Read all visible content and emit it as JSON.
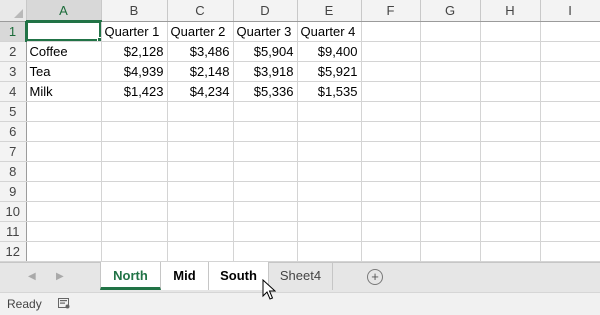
{
  "columns": [
    "A",
    "B",
    "C",
    "D",
    "E",
    "F",
    "G",
    "H",
    "I"
  ],
  "rows": [
    {
      "num": "1",
      "cells": [
        "",
        "Quarter 1",
        "Quarter 2",
        "Quarter 3",
        "Quarter 4",
        "",
        "",
        "",
        ""
      ]
    },
    {
      "num": "2",
      "cells": [
        "Coffee",
        "$2,128",
        "$3,486",
        "$5,904",
        "$9,400",
        "",
        "",
        "",
        ""
      ]
    },
    {
      "num": "3",
      "cells": [
        "Tea",
        "$4,939",
        "$2,148",
        "$3,918",
        "$5,921",
        "",
        "",
        "",
        ""
      ]
    },
    {
      "num": "4",
      "cells": [
        "Milk",
        "$1,423",
        "$4,234",
        "$5,336",
        "$1,535",
        "",
        "",
        "",
        ""
      ]
    },
    {
      "num": "5",
      "cells": [
        "",
        "",
        "",
        "",
        "",
        "",
        "",
        "",
        ""
      ]
    },
    {
      "num": "6",
      "cells": [
        "",
        "",
        "",
        "",
        "",
        "",
        "",
        "",
        ""
      ]
    },
    {
      "num": "7",
      "cells": [
        "",
        "",
        "",
        "",
        "",
        "",
        "",
        "",
        ""
      ]
    },
    {
      "num": "8",
      "cells": [
        "",
        "",
        "",
        "",
        "",
        "",
        "",
        "",
        ""
      ]
    },
    {
      "num": "9",
      "cells": [
        "",
        "",
        "",
        "",
        "",
        "",
        "",
        "",
        ""
      ]
    },
    {
      "num": "10",
      "cells": [
        "",
        "",
        "",
        "",
        "",
        "",
        "",
        "",
        ""
      ]
    },
    {
      "num": "11",
      "cells": [
        "",
        "",
        "",
        "",
        "",
        "",
        "",
        "",
        ""
      ]
    },
    {
      "num": "12",
      "cells": [
        "",
        "",
        "",
        "",
        "",
        "",
        "",
        "",
        ""
      ]
    }
  ],
  "active_cell": "A1",
  "sheet_tabs": [
    {
      "label": "North",
      "state": "active"
    },
    {
      "label": "Mid",
      "state": "selected"
    },
    {
      "label": "South",
      "state": "selected"
    },
    {
      "label": "Sheet4",
      "state": "normal"
    }
  ],
  "tab_nav": {
    "prev_icon": "◀",
    "next_icon": "▶",
    "add_icon": "+"
  },
  "status": {
    "ready": "Ready"
  },
  "colors": {
    "accent": "#217346",
    "header_bg": "#f3f3f3",
    "gridline": "#d4d4d4"
  }
}
